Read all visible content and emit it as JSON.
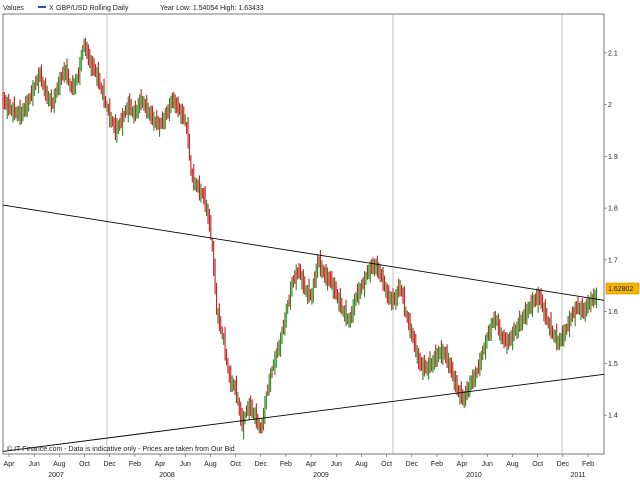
{
  "header": {
    "values_label": "Values",
    "legend_x": "X",
    "series_label": "GBP/USD Rolling Daily",
    "year_range_text": "Year Low: 1.54054 High: 1.63433"
  },
  "footer": {
    "copyright": "© IT-Finance.com - Data is indicative only - Prices are taken from Our Bid"
  },
  "colors": {
    "up": "#2e8b1e",
    "down": "#c81e1e",
    "grid": "#9a9a9a",
    "trendline": "#000000",
    "last_price_bg": "#f5b400"
  },
  "chart_data": {
    "type": "candlestick",
    "title": "GBP/USD Rolling Daily",
    "ylim": [
      1.325,
      2.175
    ],
    "yticks": [
      "2.1",
      "2",
      "1.9",
      "1.8",
      "1.7",
      "1.6",
      "1.5",
      "1.4"
    ],
    "month_labels": [
      "Apr",
      "Jun",
      "Aug",
      "Oct",
      "Dec",
      "Feb",
      "Apr",
      "Jun",
      "Aug",
      "Oct",
      "Dec",
      "Feb",
      "Apr",
      "Jun",
      "Aug",
      "Oct",
      "Dec",
      "Feb",
      "Apr",
      "Jun",
      "Aug",
      "Oct",
      "Dec",
      "Feb"
    ],
    "year_labels": [
      "2007",
      "2008",
      "2009",
      "2010",
      "2011"
    ],
    "last_price": "1.62802",
    "price_path": [
      [
        0,
        2.01
      ],
      [
        3,
        1.99
      ],
      [
        6,
        1.98
      ],
      [
        8,
        2.0
      ],
      [
        10,
        2.03
      ],
      [
        12,
        2.06
      ],
      [
        14,
        2.02
      ],
      [
        16,
        2.0
      ],
      [
        18,
        2.04
      ],
      [
        20,
        2.07
      ],
      [
        22,
        2.03
      ],
      [
        24,
        2.05
      ],
      [
        26,
        2.12
      ],
      [
        28,
        2.08
      ],
      [
        30,
        2.06
      ],
      [
        32,
        2.02
      ],
      [
        34,
        1.98
      ],
      [
        36,
        1.95
      ],
      [
        38,
        1.97
      ],
      [
        40,
        2.0
      ],
      [
        42,
        1.98
      ],
      [
        44,
        2.01
      ],
      [
        46,
        1.99
      ],
      [
        48,
        1.97
      ],
      [
        50,
        1.96
      ],
      [
        52,
        1.98
      ],
      [
        54,
        2.01
      ],
      [
        56,
        1.99
      ],
      [
        58,
        1.97
      ],
      [
        59,
        1.93
      ],
      [
        60,
        1.86
      ],
      [
        62,
        1.84
      ],
      [
        64,
        1.82
      ],
      [
        66,
        1.76
      ],
      [
        67,
        1.69
      ],
      [
        68,
        1.6
      ],
      [
        70,
        1.55
      ],
      [
        72,
        1.47
      ],
      [
        74,
        1.45
      ],
      [
        76,
        1.38
      ],
      [
        78,
        1.42
      ],
      [
        80,
        1.4
      ],
      [
        82,
        1.37
      ],
      [
        84,
        1.45
      ],
      [
        86,
        1.5
      ],
      [
        88,
        1.54
      ],
      [
        90,
        1.6
      ],
      [
        92,
        1.66
      ],
      [
        94,
        1.68
      ],
      [
        96,
        1.64
      ],
      [
        98,
        1.63
      ],
      [
        100,
        1.7
      ],
      [
        102,
        1.67
      ],
      [
        104,
        1.66
      ],
      [
        106,
        1.63
      ],
      [
        108,
        1.6
      ],
      [
        110,
        1.58
      ],
      [
        112,
        1.63
      ],
      [
        114,
        1.65
      ],
      [
        116,
        1.68
      ],
      [
        118,
        1.69
      ],
      [
        120,
        1.67
      ],
      [
        122,
        1.63
      ],
      [
        124,
        1.62
      ],
      [
        126,
        1.65
      ],
      [
        128,
        1.59
      ],
      [
        130,
        1.55
      ],
      [
        132,
        1.5
      ],
      [
        134,
        1.49
      ],
      [
        136,
        1.5
      ],
      [
        138,
        1.52
      ],
      [
        140,
        1.52
      ],
      [
        142,
        1.49
      ],
      [
        144,
        1.45
      ],
      [
        146,
        1.43
      ],
      [
        148,
        1.46
      ],
      [
        150,
        1.48
      ],
      [
        152,
        1.52
      ],
      [
        154,
        1.56
      ],
      [
        156,
        1.59
      ],
      [
        158,
        1.55
      ],
      [
        160,
        1.54
      ],
      [
        162,
        1.56
      ],
      [
        164,
        1.58
      ],
      [
        166,
        1.6
      ],
      [
        168,
        1.62
      ],
      [
        170,
        1.63
      ],
      [
        172,
        1.59
      ],
      [
        174,
        1.56
      ],
      [
        176,
        1.54
      ],
      [
        178,
        1.56
      ],
      [
        180,
        1.59
      ],
      [
        182,
        1.61
      ],
      [
        184,
        1.6
      ],
      [
        186,
        1.62
      ],
      [
        188,
        1.63
      ]
    ],
    "trendlines": [
      {
        "start": [
          0,
          1.806
        ],
        "end": [
          190,
          1.622
        ]
      },
      {
        "start": [
          0,
          1.33
        ],
        "end": [
          190,
          1.479
        ]
      }
    ]
  }
}
